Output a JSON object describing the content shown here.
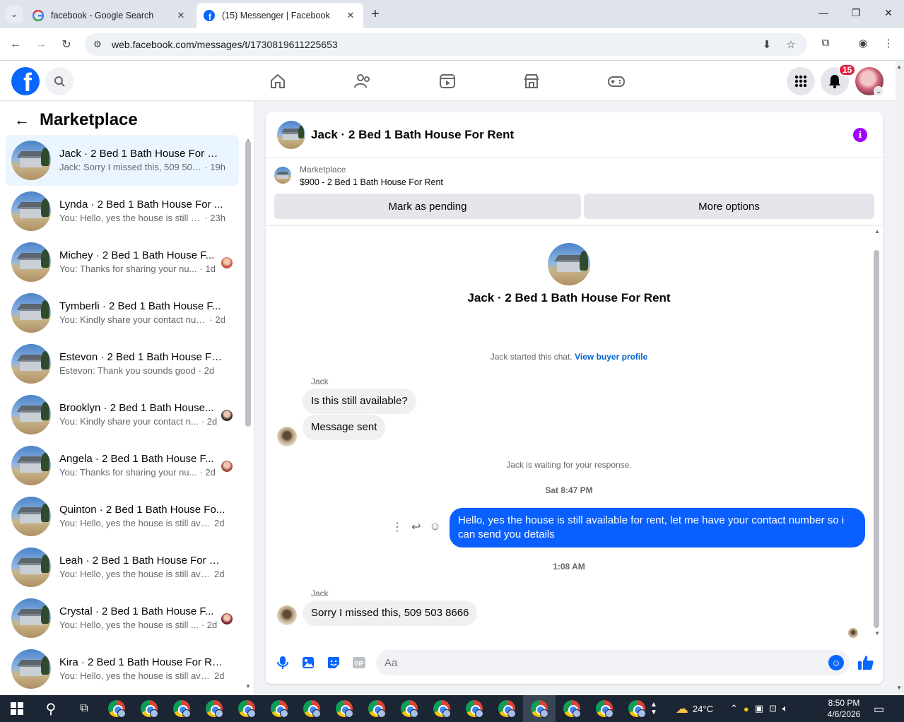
{
  "browser": {
    "tabs": [
      {
        "label": "facebook - Google Search",
        "active": false
      },
      {
        "label": "(15) Messenger | Facebook",
        "active": true
      }
    ],
    "url": "web.facebook.com/messages/t/1730819611225653"
  },
  "fbnav": {
    "notification_count": "15"
  },
  "sidebar": {
    "title": "Marketplace",
    "conversations": [
      {
        "name": "Jack · 2 Bed 1 Bath House For Rent",
        "snippet": "Jack: Sorry I missed this, 509 503 ...",
        "time": "· 19h",
        "active": true,
        "read_avatar": ""
      },
      {
        "name": "Lynda · 2 Bed 1 Bath House For ...",
        "snippet": "You: Hello, yes the house is still av...",
        "time": "· 23h",
        "active": false,
        "read_avatar": ""
      },
      {
        "name": "Michey · 2 Bed 1 Bath House F...",
        "snippet": "You: Thanks for sharing your nu...",
        "time": "· 1d",
        "active": false,
        "read_avatar": "#c8523e"
      },
      {
        "name": "Tymberli · 2 Bed 1 Bath House F...",
        "snippet": "You: Kindly share your contact num...",
        "time": "· 2d",
        "active": false,
        "read_avatar": ""
      },
      {
        "name": "Estevon · 2 Bed 1 Bath House Fo...",
        "snippet": "Estevon: Thank you sounds good",
        "time": "· 2d",
        "active": false,
        "read_avatar": ""
      },
      {
        "name": "Brooklyn · 2 Bed 1 Bath House...",
        "snippet": "You: Kindly share your contact n...",
        "time": "· 2d",
        "active": false,
        "read_avatar": "#2b2b2b"
      },
      {
        "name": "Angela · 2 Bed 1 Bath House F...",
        "snippet": "You: Thanks for sharing your nu...",
        "time": "· 2d",
        "active": false,
        "read_avatar": "#9c4a3a"
      },
      {
        "name": "Quinton · 2 Bed 1 Bath House Fo...",
        "snippet": "You: Hello, yes the house is still ava...",
        "time": "2d",
        "active": false,
        "read_avatar": ""
      },
      {
        "name": "Leah · 2 Bed 1 Bath House For R...",
        "snippet": "You: Hello, yes the house is still ava...",
        "time": "2d",
        "active": false,
        "read_avatar": ""
      },
      {
        "name": "Crystal · 2 Bed 1 Bath House F...",
        "snippet": "You: Hello, yes the house is still ...",
        "time": "· 2d",
        "active": false,
        "read_avatar": "#7a1e2e"
      },
      {
        "name": "Kira · 2 Bed 1 Bath House For Rent",
        "snippet": "You: Hello, yes the house is still ava...",
        "time": "2d",
        "active": false,
        "read_avatar": ""
      }
    ]
  },
  "chat": {
    "title": "Jack · 2 Bed 1 Bath House For Rent",
    "listing_label": "Marketplace",
    "listing_price": "$900 - 2 Bed 1 Bath House For Rent",
    "mark_pending": "Mark as pending",
    "more_options": "More options",
    "intro_title": "Jack · 2 Bed 1 Bath House For Rent",
    "started_text": "Jack started this chat.",
    "view_profile": "View buyer profile",
    "sender1": "Jack",
    "msg1": "Is this still available?",
    "msg2": "Message sent",
    "waiting_text": "Jack is waiting for your response.",
    "ts1": "Sat 8:47 PM",
    "out_msg": "Hello, yes the house is still available for rent, let me have your contact number so i can send you  details",
    "ts2": "1:08 AM",
    "sender2": "Jack",
    "msg3": "Sorry I missed this, 509 503 8666",
    "composer_placeholder": "Aa"
  },
  "taskbar": {
    "weather": "24°C",
    "time": "8:50 PM",
    "date": "4/6/2026",
    "chrome_count": 17
  },
  "colors": {
    "fb_blue": "#0866ff",
    "out_bubble": "#0a60ff",
    "badge_red": "#e41e3f",
    "info_purple": "#a100ff"
  }
}
